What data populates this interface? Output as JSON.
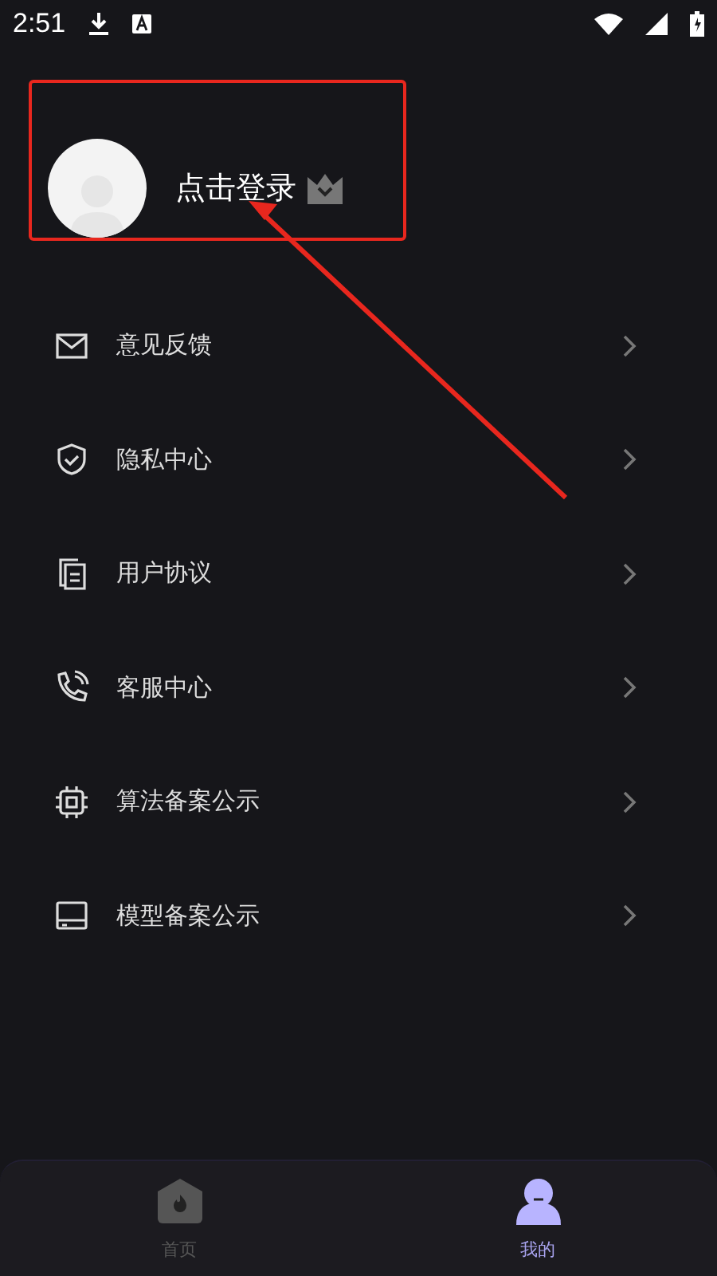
{
  "status_bar": {
    "time": "2:51"
  },
  "profile": {
    "login_label": "点击登录"
  },
  "menu": [
    {
      "label": "意见反馈"
    },
    {
      "label": "隐私中心"
    },
    {
      "label": "用户协议"
    },
    {
      "label": "客服中心"
    },
    {
      "label": "算法备案公示"
    },
    {
      "label": "模型备案公示"
    }
  ],
  "tabs": [
    {
      "label": "首页",
      "selected": false
    },
    {
      "label": "我的",
      "selected": true
    }
  ]
}
